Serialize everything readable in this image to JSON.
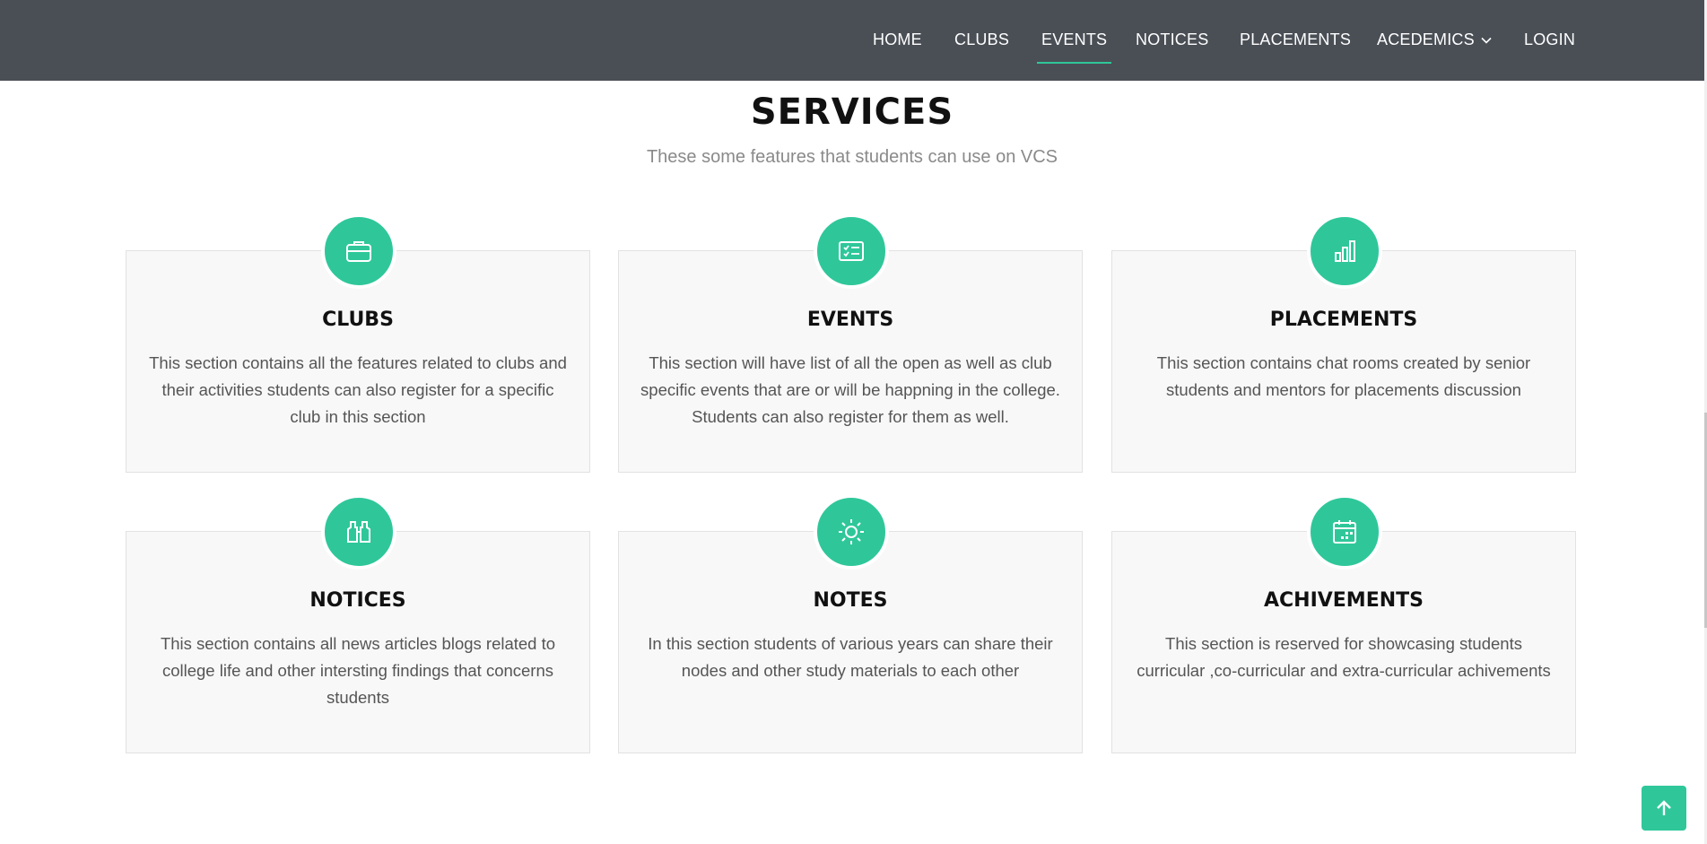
{
  "nav": {
    "items": [
      {
        "label": "HOME"
      },
      {
        "label": "CLUBS"
      },
      {
        "label": "EVENTS",
        "active": true
      },
      {
        "label": "NOTICES"
      },
      {
        "label": "PLACEMENTS"
      },
      {
        "label": "ACEDEMICS",
        "dropdown": true
      },
      {
        "label": "LOGIN"
      }
    ]
  },
  "services": {
    "title": "SERVICES",
    "subtitle": "These some features that students can use on VCS",
    "cards": [
      {
        "icon": "briefcase-icon",
        "title": "CLUBS",
        "desc": "This section contains all the features related to clubs and their activities students can also register for a specific club in this section"
      },
      {
        "icon": "card-checklist-icon",
        "title": "EVENTS",
        "desc": "This section will have list of all the open as well as club specific events that are or will be happning in the college. Students can also register for them as well."
      },
      {
        "icon": "bar-chart-icon",
        "title": "PLACEMENTS",
        "desc": "This section contains chat rooms created by senior students and mentors for placements discussion"
      },
      {
        "icon": "binoculars-icon",
        "title": "NOTICES",
        "desc": "This section contains all news articles blogs related to college life and other intersting findings that concerns students"
      },
      {
        "icon": "brightness-icon",
        "title": "NOTES",
        "desc": "In this section students of various years can share their nodes and other study materials to each other"
      },
      {
        "icon": "calendar-icon",
        "title": "ACHIVEMENTS",
        "desc": "This section is reserved for showcasing students curricular ,co-curricular and extra-curricular achivements"
      }
    ]
  },
  "colors": {
    "accent": "#2fc79a",
    "navbar": "#4a4f56"
  },
  "back_to_top": {
    "icon": "arrow-up-icon"
  }
}
